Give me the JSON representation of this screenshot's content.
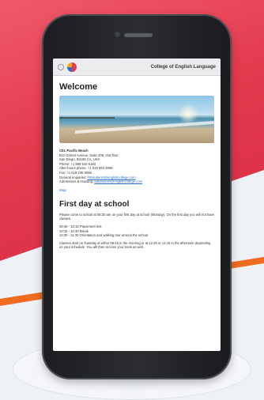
{
  "browser": {
    "site_title": "College of English Language"
  },
  "welcome": {
    "heading": "Welcome",
    "school_name": "CEL Pacific Beach",
    "address_line1": "810 Garnet Avenue, Suite 208, 2nd floor",
    "address_line2": "San Diego, 92109 CA, USA",
    "phone": "Phone: +1 858 510 5183",
    "after_hours": "After-hours phone: +1 619 693 4909",
    "fax": "Fax: +1 619 236 9088",
    "general_label": "General enquiries:",
    "general_email": "PBstudents@englishcollege.com",
    "admissions_label": "Admissions & Housing:",
    "admissions_email": "admissions@englishcollege.com",
    "map_link": "Map"
  },
  "first_day": {
    "heading": "First day at school",
    "intro": "Please come to school at 08:30 am on your first day at school (Monday). On the first day you will not have classes.",
    "schedule": [
      "08:45 - 10:15 Placement test",
      "10:15 - 10:30 Break",
      "10:30 - 11:30 Orientation and walking tour around the school"
    ],
    "classes": "Classes start on Tuesday at either 08:45 in the morning or at 12:30 or 14:15 in the afternoon depending on your schedule. You will then receive your book as well."
  }
}
